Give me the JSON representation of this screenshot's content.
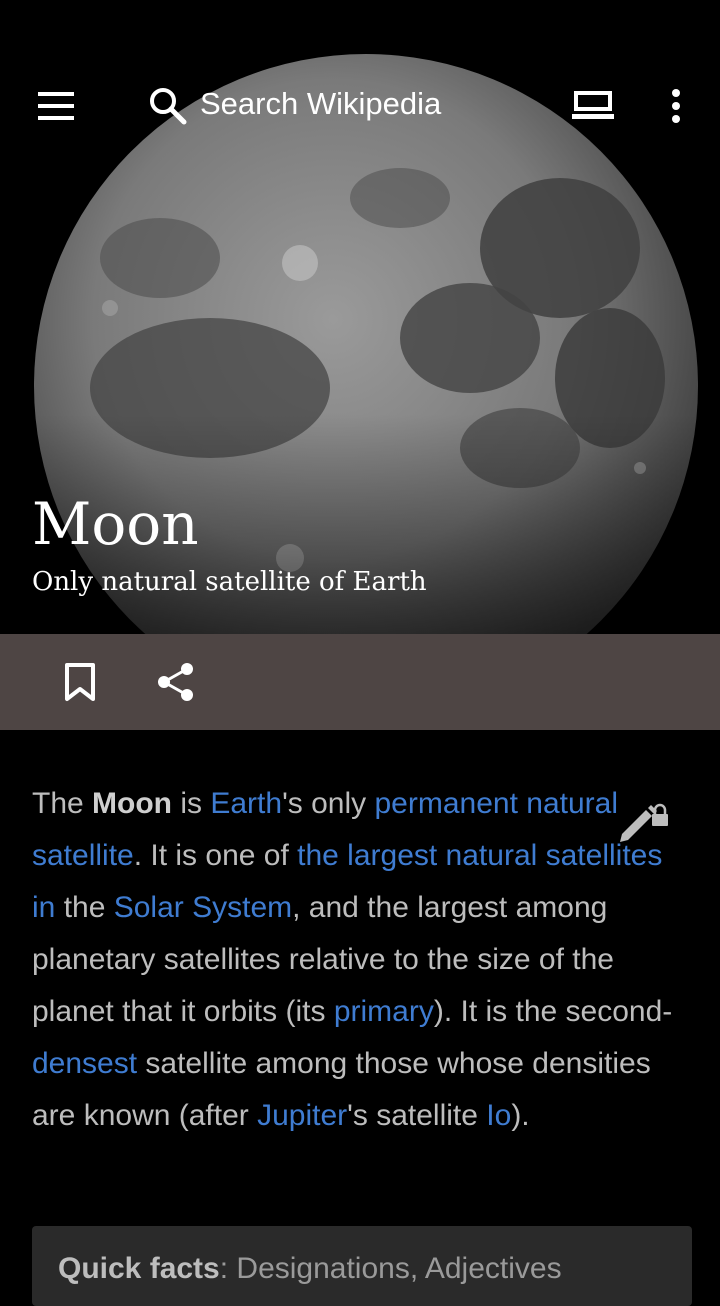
{
  "header": {
    "search_placeholder": "Search Wikipedia",
    "icons": [
      "menu-icon",
      "search-icon",
      "reading-list-icon",
      "overflow-menu-icon"
    ]
  },
  "load_progress": 0.025,
  "article": {
    "title": "Moon",
    "description": "Only natural satellite of Earth",
    "actions": [
      "bookmark-icon",
      "share-icon"
    ],
    "lead": {
      "t1": "The ",
      "bold": "Moon",
      "t2": " is ",
      "link_earth": "Earth",
      "t3": "'s only ",
      "link_permanent": "permanent natural satellite",
      "t4": ". It is one of ",
      "link_largest": "the largest natural satellites in",
      "t5": " the ",
      "link_solar": "Solar System",
      "t6": ", and the largest among planetary satellites relative to the size of the planet that it orbits (its ",
      "link_primary": "primary",
      "t7": "). It is the second-",
      "link_densest": "densest",
      "t8": " satellite among those whose densities are known (after ",
      "link_jupiter": "Jupiter",
      "t9": "'s satellite ",
      "link_io": "Io",
      "t10": ")."
    },
    "quick_facts": {
      "label": "Quick facts",
      "sep": ": ",
      "items": "Designations, Adjectives"
    }
  },
  "colors": {
    "link": "#3f7cd1",
    "action_bar": "#4e4544",
    "progress": "#3b8fd6"
  }
}
